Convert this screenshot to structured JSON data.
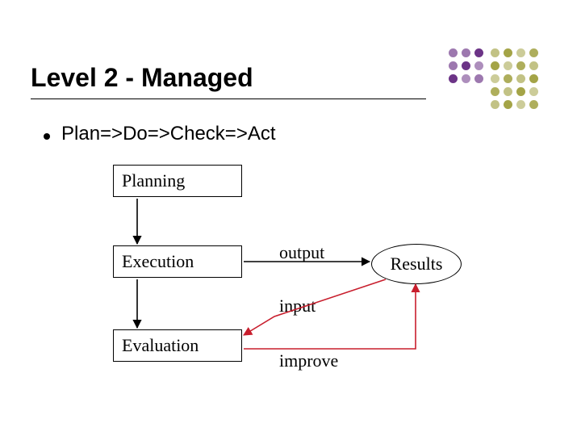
{
  "title": "Level 2 - Managed",
  "bullet": "Plan=>Do=>Check=>Act",
  "boxes": {
    "planning": "Planning",
    "execution": "Execution",
    "evaluation": "Evaluation"
  },
  "results": "Results",
  "labels": {
    "output": "output",
    "input": "input",
    "improve": "improve"
  },
  "colors": {
    "accent_purple": "#5c1e7a",
    "accent_olive": "#9a9a33",
    "feedback_red": "#c81e2d",
    "black": "#000000"
  },
  "chart_data": {
    "type": "diagram",
    "title": "Level 2 - Managed",
    "subtitle": "Plan=>Do=>Check=>Act",
    "nodes": [
      {
        "id": "planning",
        "label": "Planning",
        "shape": "rect"
      },
      {
        "id": "execution",
        "label": "Execution",
        "shape": "rect"
      },
      {
        "id": "evaluation",
        "label": "Evaluation",
        "shape": "rect"
      },
      {
        "id": "results",
        "label": "Results",
        "shape": "ellipse"
      }
    ],
    "edges": [
      {
        "from": "planning",
        "to": "execution",
        "label": "",
        "color": "black"
      },
      {
        "from": "execution",
        "to": "evaluation",
        "label": "",
        "color": "black"
      },
      {
        "from": "execution",
        "to": "results",
        "label": "output",
        "color": "black"
      },
      {
        "from": "results",
        "to": "evaluation",
        "label": "input",
        "color": "red"
      },
      {
        "from": "evaluation",
        "to": "results",
        "label": "improve",
        "color": "red"
      }
    ]
  }
}
